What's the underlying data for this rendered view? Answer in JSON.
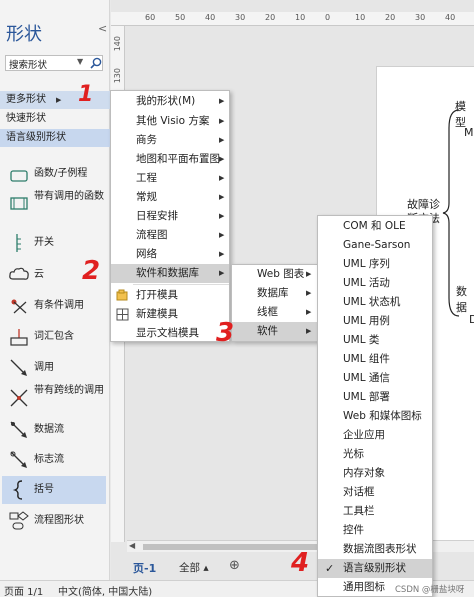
{
  "shapes_panel": {
    "title": "形状",
    "collapse_icon": "chevron-left-icon",
    "search": {
      "value": "搜索形状"
    },
    "nav": {
      "more": "更多形状",
      "quick": "快速形状",
      "lang": "语言级别形状"
    },
    "shapes": [
      {
        "label": "函数/子例程",
        "icon": "function-icon"
      },
      {
        "label": "带有调用的函数",
        "icon": "function-call-icon"
      },
      {
        "label": "开关",
        "icon": "switch-icon"
      },
      {
        "label": "云",
        "icon": "cloud-icon"
      },
      {
        "label": "有条件调用",
        "icon": "conditional-call-icon"
      },
      {
        "label": "词汇包含",
        "icon": "lexical-include-icon"
      },
      {
        "label": "调用",
        "icon": "call-icon"
      },
      {
        "label": "带有跨线的调用",
        "icon": "call-crossing-icon"
      },
      {
        "label": "数据流",
        "icon": "data-flow-icon"
      },
      {
        "label": "标志流",
        "icon": "flag-flow-icon"
      },
      {
        "label": "括号",
        "icon": "brace-icon"
      },
      {
        "label": "流程图形状",
        "icon": "flowchart-icon"
      }
    ]
  },
  "menu1": {
    "items": [
      {
        "label": "我的形状(M)",
        "submenu": true
      },
      {
        "label": "其他 Visio 方案",
        "submenu": true
      },
      {
        "label": "商务",
        "submenu": true
      },
      {
        "label": "地图和平面布置图",
        "submenu": true
      },
      {
        "label": "工程",
        "submenu": true
      },
      {
        "label": "常规",
        "submenu": true
      },
      {
        "label": "日程安排",
        "submenu": true
      },
      {
        "label": "流程图",
        "submenu": true
      },
      {
        "label": "网络",
        "submenu": true
      },
      {
        "label": "软件和数据库",
        "submenu": true
      },
      {
        "label": "打开模具",
        "submenu": false
      },
      {
        "label": "新建模具",
        "submenu": false
      },
      {
        "label": "显示文档模具",
        "submenu": false
      }
    ]
  },
  "menu2": {
    "items": [
      {
        "label": "Web 图表"
      },
      {
        "label": "数据库"
      },
      {
        "label": "线框"
      },
      {
        "label": "软件"
      }
    ]
  },
  "menu3": {
    "items": [
      "COM 和 OLE",
      "Gane-Sarson",
      "UML 序列",
      "UML 活动",
      "UML 状态机",
      "UML 用例",
      "UML 类",
      "UML 组件",
      "UML 通信",
      "UML 部署",
      "Web 和媒体图标",
      "企业应用",
      "光标",
      "内存对象",
      "对话框",
      "工具栏",
      "控件",
      "数据流图表形状",
      "语言级别形状",
      "通用图标"
    ],
    "checked_index": 18
  },
  "ruler": {
    "top": [
      "60",
      "50",
      "40",
      "30",
      "20",
      "10",
      "0",
      "10",
      "20",
      "30",
      "40"
    ],
    "left": [
      "140",
      "130"
    ]
  },
  "diagram": {
    "texts": [
      "模型",
      "M",
      "故障诊",
      "断方法",
      "数据",
      "D"
    ]
  },
  "page_tabs": {
    "page1": "页-1",
    "all": "全部",
    "all_arrow": "▴",
    "add": "⊕"
  },
  "status": {
    "page": "页面 1/1",
    "language": "中文(简体, 中国大陆)"
  },
  "watermark": "CSDN @栅盐块呀",
  "annotations": [
    "1",
    "2",
    "3",
    "4"
  ],
  "colors": {
    "accent": "#2b579a",
    "annotation": "#e02020",
    "selected": "#c7d7ee"
  }
}
